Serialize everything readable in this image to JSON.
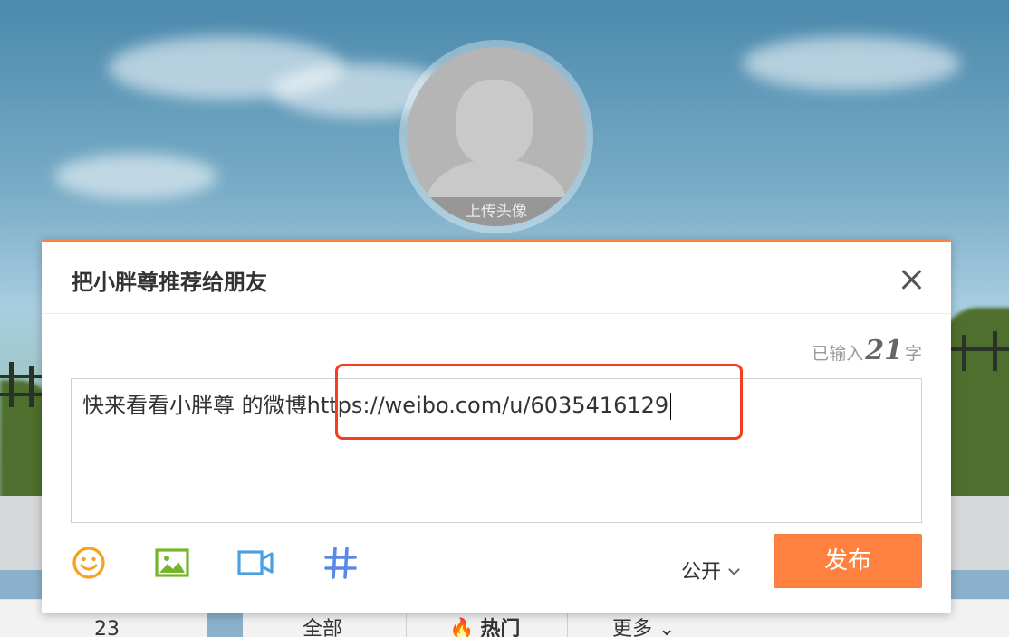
{
  "background": {
    "avatar_upload_label": "上传头像",
    "stats": {
      "count": "23"
    },
    "tabs": [
      {
        "label": "全部"
      },
      {
        "label": "热门"
      },
      {
        "label": "更多"
      }
    ]
  },
  "dialog": {
    "title": "把小胖尊推荐给朋友",
    "counter": {
      "prefix": "已输入",
      "count": "21",
      "suffix": "字"
    },
    "textarea": {
      "text": "快来看看小胖尊 的微博",
      "link": "https://weibo.com/u/6035416129"
    },
    "toolbar": {
      "icons": [
        "emoji-icon",
        "image-icon",
        "video-icon",
        "topic-hashtag-icon"
      ]
    },
    "privacy": {
      "label": "公开"
    },
    "publish_label": "发布"
  },
  "colors": {
    "accent": "#ff8140",
    "highlight_border": "#f53d1f",
    "emoji_icon": "#f7a21c",
    "image_icon": "#74b52c",
    "video_icon": "#4aa0e0",
    "hashtag_icon": "#5b89e6"
  }
}
